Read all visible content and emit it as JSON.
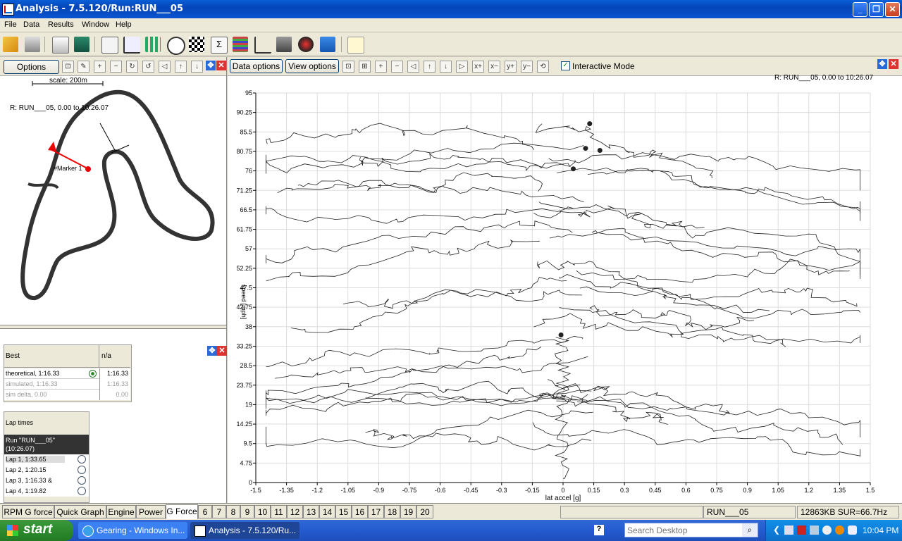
{
  "window": {
    "title": "Analysis - 7.5.120/Run:RUN___05"
  },
  "menu": [
    "File",
    "Data",
    "Results",
    "Window",
    "Help"
  ],
  "left_panel": {
    "options_label": "Options",
    "scale_label": "scale: 200m",
    "run_label": "R:  RUN___05, 0.00 to 10:26.07",
    "marker_label": "#Marker 1"
  },
  "best_table": {
    "header": "Best",
    "header_value": "n/a",
    "rows": [
      {
        "label": "theoretical, 1:16.33",
        "value": "1:16.33"
      },
      {
        "label": "simulated, 1:16.33",
        "value": "1:16.33"
      },
      {
        "label": "sim delta, 0.00",
        "value": "0.00"
      }
    ]
  },
  "lap_table": {
    "header": "Lap times",
    "run_name": "Run \"RUN___05\"",
    "run_time": "(10:26.07)",
    "laps": [
      "Lap 1, 1:33.65",
      "Lap 2, 1:20.15",
      "Lap 3, 1:16.33  &",
      "Lap 4, 1:19.82"
    ]
  },
  "right_panel": {
    "data_options_label": "Data options",
    "view_options_label": "View options",
    "interactive_mode_label": "Interactive Mode",
    "interactive_mode_checked": true,
    "run_label": "R:  RUN___05, 0.00 to 10:26.07"
  },
  "chart_data": {
    "type": "scatter",
    "title": "",
    "xlabel": "lat accel [g]",
    "ylabel": "speed [mph]",
    "xlim": [
      -1.5,
      1.5
    ],
    "ylim": [
      0,
      95
    ],
    "x_ticks": [
      "-1.5",
      "-1.35",
      "-1.2",
      "-1.05",
      "-0.9",
      "-0.75",
      "-0.6",
      "-0.45",
      "-0.3",
      "-0.15",
      "0",
      "0.15",
      "0.3",
      "0.45",
      "0.6",
      "0.75",
      "0.9",
      "1.05",
      "1.2",
      "1.35",
      "1.5"
    ],
    "y_ticks": [
      "0",
      "4.75",
      "9.5",
      "14.25",
      "19",
      "23.75",
      "28.5",
      "33.25",
      "38",
      "42.75",
      "47.5",
      "52.25",
      "57",
      "61.75",
      "66.5",
      "71.25",
      "76",
      "80.75",
      "85.5",
      "90.25",
      "95"
    ],
    "grid": true,
    "markers": [
      {
        "x": 0.13,
        "y": 87.5
      },
      {
        "x": 0.11,
        "y": 81.5
      },
      {
        "x": 0.18,
        "y": 81.0
      },
      {
        "x": 0.05,
        "y": 76.5
      },
      {
        "x": -0.01,
        "y": 36.0
      }
    ]
  },
  "tabs": [
    "RPM G force",
    "Quick Graph",
    "Engine",
    "Power",
    "G Force",
    "6",
    "7",
    "8",
    "9",
    "10",
    "11",
    "12",
    "13",
    "14",
    "15",
    "16",
    "17",
    "18",
    "19",
    "20"
  ],
  "active_tab": "G Force",
  "status": {
    "run": "RUN___05",
    "memory": "12863KB SUR=66.7Hz"
  },
  "taskbar": {
    "start_label": "start",
    "tasks": [
      "Gearing - Windows In...",
      "Analysis - 7.5.120/Ru..."
    ],
    "search_placeholder": "Search Desktop",
    "clock": "10:04 PM"
  }
}
